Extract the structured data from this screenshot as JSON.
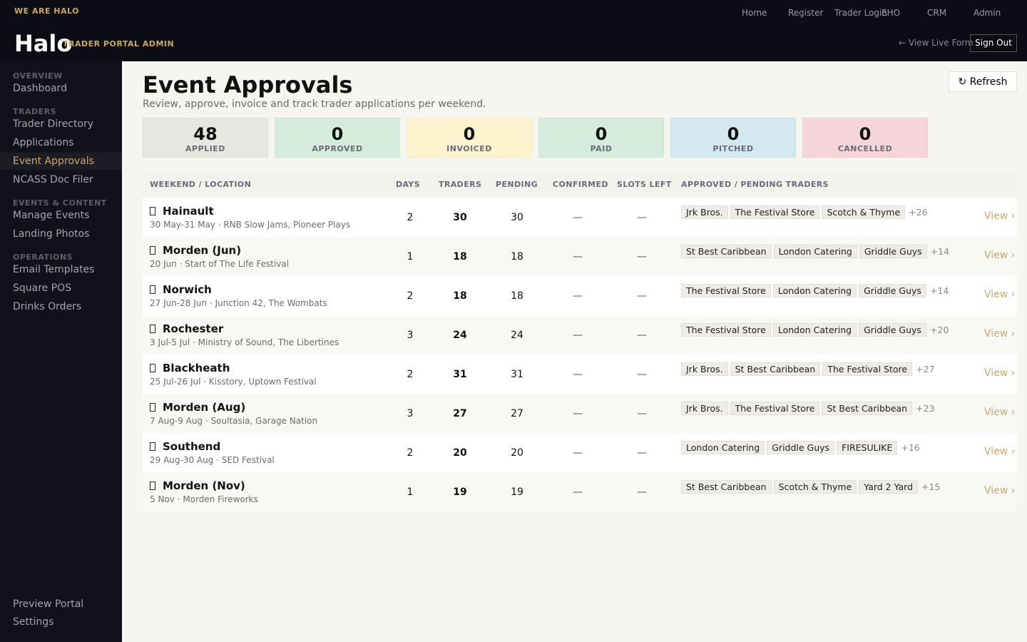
{
  "header": {
    "tagline": "WE ARE HALO",
    "logo": "Halo",
    "subtitle": "TRADER PORTAL ADMIN",
    "nav": [
      "Home",
      "Register",
      "Trader Login",
      "EHO",
      "CRM",
      "Admin"
    ],
    "view_live": "← View Live Form",
    "sign_out": "Sign Out"
  },
  "sidebar": {
    "sections": [
      {
        "title": "OVERVIEW",
        "items": [
          "Dashboard"
        ]
      },
      {
        "title": "TRADERS",
        "items": [
          "Trader Directory",
          "Applications",
          "Event Approvals",
          "NCASS Doc Filer"
        ]
      },
      {
        "title": "EVENTS & CONTENT",
        "items": [
          "Manage Events",
          "Landing Photos"
        ]
      },
      {
        "title": "OPERATIONS",
        "items": [
          "Email Templates",
          "Square POS",
          "Drinks Orders"
        ]
      }
    ],
    "active": "Event Approvals",
    "bottom": [
      "Preview Portal",
      "Settings"
    ]
  },
  "page": {
    "title": "Event Approvals",
    "subtitle": "Review, approve, invoice and track trader applications per weekend.",
    "refresh": "↻ Refresh"
  },
  "stats": [
    {
      "value": "48",
      "label": "APPLIED",
      "color": "#e8e6e0"
    },
    {
      "value": "0",
      "label": "APPROVED",
      "color": "#d5ecdd"
    },
    {
      "value": "0",
      "label": "INVOICED",
      "color": "#fdf3cf"
    },
    {
      "value": "0",
      "label": "PAID",
      "color": "#d5ecdd"
    },
    {
      "value": "0",
      "label": "PITCHED",
      "color": "#d3e9ef"
    },
    {
      "value": "0",
      "label": "CANCELLED",
      "color": "#f6d5da"
    }
  ],
  "table": {
    "columns": [
      "WEEKEND / LOCATION",
      "DAYS",
      "TRADERS",
      "PENDING",
      "CONFIRMED",
      "SLOTS LEFT",
      "APPROVED / PENDING TRADERS"
    ],
    "view_label": "View ›",
    "rows": [
      {
        "name": "Hainault",
        "meta": "30 May-31 May · RNB Slow Jams, Pioneer Plays",
        "days": "2",
        "traders": "30",
        "pending": "30",
        "confirmed": "—",
        "slots": "—",
        "chips": [
          "Jrk Bros.",
          "The Festival Store",
          "Scotch & Thyme"
        ],
        "more": "+26"
      },
      {
        "name": "Morden (Jun)",
        "meta": "20 Jun · Start of The Life Festival",
        "days": "1",
        "traders": "18",
        "pending": "18",
        "confirmed": "—",
        "slots": "—",
        "chips": [
          "St Best Caribbean",
          "London Catering",
          "Griddle Guys"
        ],
        "more": "+14"
      },
      {
        "name": "Norwich",
        "meta": "27 Jun-28 Jun · Junction 42, The Wombats",
        "days": "2",
        "traders": "18",
        "pending": "18",
        "confirmed": "—",
        "slots": "—",
        "chips": [
          "The Festival Store",
          "London Catering",
          "Griddle Guys"
        ],
        "more": "+14"
      },
      {
        "name": "Rochester",
        "meta": "3 Jul-5 Jul · Ministry of Sound, The Libertines",
        "days": "3",
        "traders": "24",
        "pending": "24",
        "confirmed": "—",
        "slots": "—",
        "chips": [
          "The Festival Store",
          "London Catering",
          "Griddle Guys"
        ],
        "more": "+20"
      },
      {
        "name": "Blackheath",
        "meta": "25 Jul-26 Jul · Kisstory, Uptown Festival",
        "days": "2",
        "traders": "31",
        "pending": "31",
        "confirmed": "—",
        "slots": "—",
        "chips": [
          "Jrk Bros.",
          "St Best Caribbean",
          "The Festival Store"
        ],
        "more": "+27"
      },
      {
        "name": "Morden (Aug)",
        "meta": "7 Aug-9 Aug · Soultasia, Garage Nation",
        "days": "3",
        "traders": "27",
        "pending": "27",
        "confirmed": "—",
        "slots": "—",
        "chips": [
          "Jrk Bros.",
          "The Festival Store",
          "St Best Caribbean"
        ],
        "more": "+23"
      },
      {
        "name": "Southend",
        "meta": "29 Aug-30 Aug · SED Festival",
        "days": "2",
        "traders": "20",
        "pending": "20",
        "confirmed": "—",
        "slots": "—",
        "chips": [
          "London Catering",
          "Griddle Guys",
          "FIRESULIKE"
        ],
        "more": "+16"
      },
      {
        "name": "Morden (Nov)",
        "meta": "5 Nov · Morden Fireworks",
        "days": "1",
        "traders": "19",
        "pending": "19",
        "confirmed": "—",
        "slots": "—",
        "chips": [
          "St Best Caribbean",
          "Scotch & Thyme",
          "Yard 2 Yard"
        ],
        "more": "+15"
      }
    ]
  }
}
